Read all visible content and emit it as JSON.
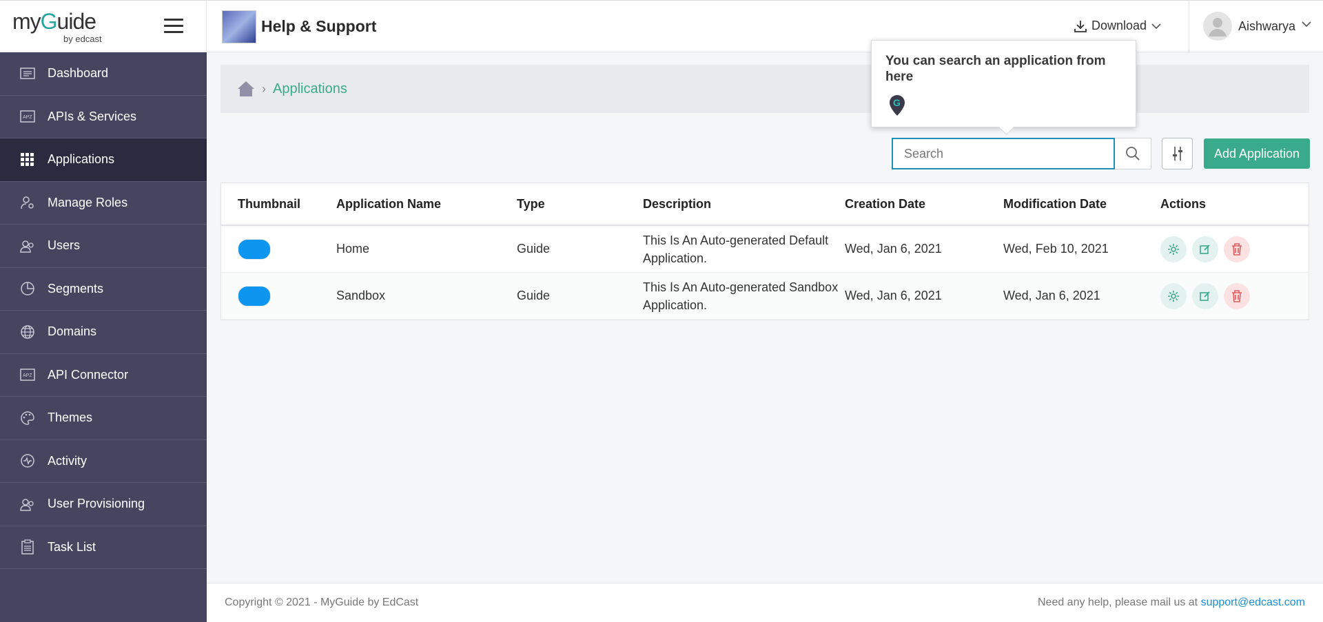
{
  "header": {
    "logo_text_1": "my",
    "logo_text_2": "uide",
    "logo_by": "by edcast",
    "app_title": "Help & Support",
    "download_label": "Download",
    "username": "Aishwarya"
  },
  "sidebar": {
    "items": [
      {
        "label": "Dashboard",
        "icon": "dashboard-icon"
      },
      {
        "label": "APIs & Services",
        "icon": "api-icon"
      },
      {
        "label": "Applications",
        "icon": "grid-icon",
        "active": true
      },
      {
        "label": "Manage Roles",
        "icon": "user-settings-icon"
      },
      {
        "label": "Users",
        "icon": "users-icon"
      },
      {
        "label": "Segments",
        "icon": "pie-icon"
      },
      {
        "label": "Domains",
        "icon": "globe-icon"
      },
      {
        "label": "API Connector",
        "icon": "api-connector-icon"
      },
      {
        "label": "Themes",
        "icon": "palette-icon"
      },
      {
        "label": "Activity",
        "icon": "activity-icon"
      },
      {
        "label": "User Provisioning",
        "icon": "users-icon"
      },
      {
        "label": "Task List",
        "icon": "clipboard-icon"
      }
    ]
  },
  "breadcrumb": {
    "current": "Applications"
  },
  "search": {
    "placeholder": "Search"
  },
  "toolbar": {
    "add_label": "Add Application"
  },
  "tooltip": {
    "text": "You can search an application from here"
  },
  "table": {
    "headers": [
      "Thumbnail",
      "Application Name",
      "Type",
      "Description",
      "Creation Date",
      "Modification Date",
      "Actions"
    ],
    "rows": [
      {
        "name": "Home",
        "type": "Guide",
        "description": "This Is An Auto-generated Default Application.",
        "created": "Wed, Jan 6, 2021",
        "modified": "Wed, Feb 10, 2021"
      },
      {
        "name": "Sandbox",
        "type": "Guide",
        "description": "This Is An Auto-generated Sandbox Application.",
        "created": "Wed, Jan 6, 2021",
        "modified": "Wed, Jan 6, 2021"
      }
    ]
  },
  "footer": {
    "copyright": "Copyright © 2021 - MyGuide by EdCast",
    "help_text": "Need any help, please mail us at",
    "email": "support@edcast.com"
  },
  "colors": {
    "accent": "#3aaa8c",
    "sidebar": "#454560",
    "sidebar_active": "#2b2b40",
    "thumb_blue": "#0e95f0",
    "danger": "#e05a5a"
  }
}
